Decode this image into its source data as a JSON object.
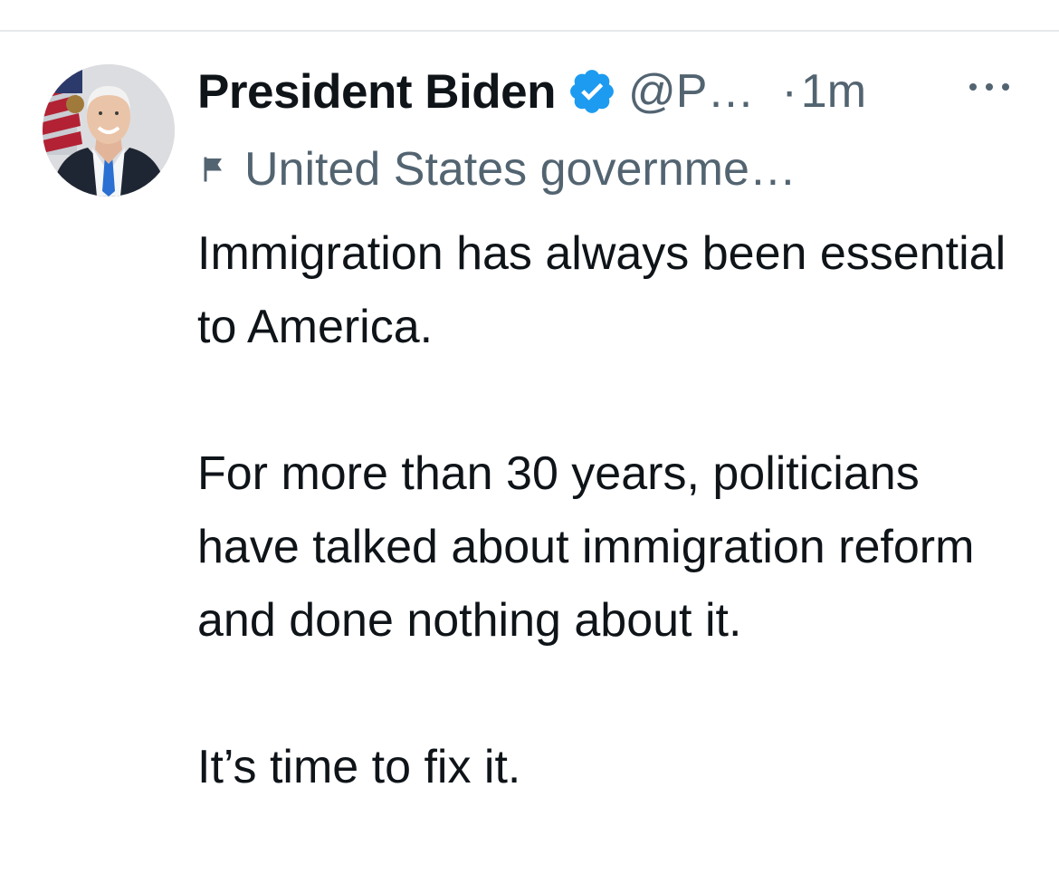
{
  "tweet": {
    "display_name": "President Biden",
    "verified_icon": "verified-badge-icon",
    "handle": "@P…",
    "separator": "·",
    "timestamp": "1m",
    "more_icon": "more-options-icon",
    "affiliation_icon": "flag-icon",
    "affiliation": "United States governme…",
    "avatar": "profile-photo",
    "paragraphs": [
      "Immigration has always been essential to America.",
      "For more than 30 years, politicians have talked about immigration reform and done nothing about it.",
      "It’s time to fix it."
    ]
  },
  "colors": {
    "text_primary": "#0f1419",
    "text_secondary": "#536471",
    "verified_blue": "#1d9bf0"
  }
}
